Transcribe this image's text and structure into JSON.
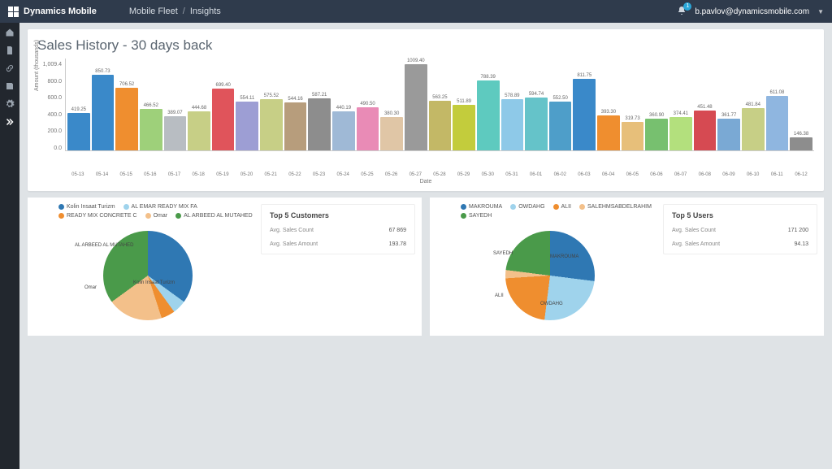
{
  "header": {
    "brand": "Dynamics Mobile",
    "breadcrumb1": "Mobile Fleet",
    "breadcrumb2": "Insights",
    "notif_count": "1",
    "user_email": "b.pavlov@dynamicsmobile.com"
  },
  "page": {
    "title": "Sales History - 30 days back",
    "ylabel": "Amount (thousands)",
    "xlabel": "Date",
    "ymax_label": "1,009.4",
    "ytick_800": "800.0",
    "ytick_600": "600.0",
    "ytick_400": "400.0",
    "ytick_200": "200.0",
    "ytick_0": "0.0"
  },
  "chart_data": {
    "type": "bar",
    "ylabel": "Amount (thousands)",
    "xlabel": "Date",
    "ylim": [
      0,
      1009.4
    ],
    "categories": [
      "05-13",
      "05-14",
      "05-15",
      "05-16",
      "05-17",
      "05-18",
      "05-19",
      "05-20",
      "05-21",
      "05-22",
      "05-23",
      "05-24",
      "05-25",
      "05-26",
      "05-27",
      "05-28",
      "05-29",
      "05-30",
      "05-31",
      "06-01",
      "06-02",
      "06-03",
      "06-04",
      "06-05",
      "06-06",
      "06-07",
      "06-08",
      "06-09",
      "06-10",
      "06-11",
      "06-12"
    ],
    "values": [
      419.25,
      850.73,
      706.52,
      466.52,
      389.07,
      444.68,
      699.4,
      554.11,
      575.52,
      544.16,
      587.21,
      440.19,
      490.5,
      380.3,
      1009.4,
      563.25,
      511.89,
      788.39,
      578.89,
      594.74,
      552.5,
      811.75,
      393.3,
      319.73,
      360.9,
      374.41,
      451.48,
      361.77,
      481.84,
      611.08,
      146.38
    ],
    "colors": [
      "#3a89c9",
      "#3a89c9",
      "#ef8e2f",
      "#9ed07a",
      "#b8bdc2",
      "#c7cf86",
      "#e0545b",
      "#9d9ed4",
      "#c7cf86",
      "#b79d7c",
      "#8d8d8d",
      "#9fb9d6",
      "#e98bb6",
      "#e0c6a6",
      "#9a9a9a",
      "#c3b866",
      "#c3cc3c",
      "#5ecabf",
      "#8ec9e8",
      "#65c3c9",
      "#4e9ec9",
      "#3a89c9",
      "#ef8e2f",
      "#e7bf7a",
      "#77c06f",
      "#b3e07d",
      "#d64a52",
      "#7aa9d4",
      "#c7cf86",
      "#8fb6e0",
      "#8d8d8d"
    ]
  },
  "customers": {
    "title": "Top 5 Customers",
    "avg_count_label": "Avg. Sales Count",
    "avg_count": "67 869",
    "avg_amount_label": "Avg. Sales Amount",
    "avg_amount": "193.78",
    "legend": [
      {
        "name": "Kolin Insaat Turizm",
        "color": "#2f78b3"
      },
      {
        "name": "AL EMAR READY MIX FA",
        "color": "#9fd3ec"
      },
      {
        "name": "READY MIX CONCRETE C",
        "color": "#ef8e2f"
      },
      {
        "name": "Omar",
        "color": "#f3c08a"
      },
      {
        "name": "AL ARBEED AL MUTAHED",
        "color": "#4a9a4a"
      }
    ],
    "pie_data": {
      "type": "pie",
      "series": [
        {
          "name": "Kolin Insaat Turizm",
          "value": 35
        },
        {
          "name": "AL EMAR READY MIX FA",
          "value": 5
        },
        {
          "name": "READY MIX CONCRETE C",
          "value": 5
        },
        {
          "name": "Omar",
          "value": 20
        },
        {
          "name": "AL ARBEED AL MUTAHED",
          "value": 35
        }
      ]
    },
    "pie_labels": {
      "a": "AL ARBEED AL MUTAHED",
      "b": "Kolin Insaat Turizm",
      "c": "Omar"
    }
  },
  "users": {
    "title": "Top 5 Users",
    "avg_count_label": "Avg. Sales Count",
    "avg_count": "171 200",
    "avg_amount_label": "Avg. Sales Amount",
    "avg_amount": "94.13",
    "legend": [
      {
        "name": "MAKROUMA",
        "color": "#2f78b3"
      },
      {
        "name": "OWDAHG",
        "color": "#9fd3ec"
      },
      {
        "name": "ALII",
        "color": "#ef8e2f"
      },
      {
        "name": "SALEHMSABDELRAHIM",
        "color": "#f3c08a"
      },
      {
        "name": "SAYEDH",
        "color": "#4a9a4a"
      }
    ],
    "pie_data": {
      "type": "pie",
      "series": [
        {
          "name": "MAKROUMA",
          "value": 27
        },
        {
          "name": "OWDAHG",
          "value": 25
        },
        {
          "name": "ALII",
          "value": 22
        },
        {
          "name": "SALEHMSABDELRAHIM",
          "value": 3
        },
        {
          "name": "SAYEDH",
          "value": 23
        }
      ]
    },
    "pie_labels": {
      "a": "MAKROUMA",
      "b": "OWDAHG",
      "c": "ALII",
      "d": "SAYEDH"
    }
  }
}
